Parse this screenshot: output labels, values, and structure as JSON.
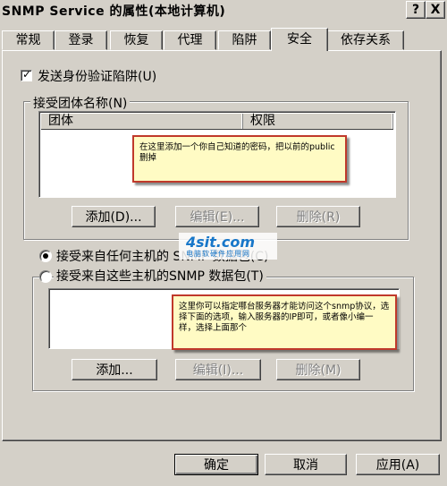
{
  "window": {
    "title": "SNMP Service 的属性(本地计算机)",
    "help_glyph": "?",
    "close_glyph": "X"
  },
  "tabs": [
    {
      "label": "常规"
    },
    {
      "label": "登录"
    },
    {
      "label": "恢复"
    },
    {
      "label": "代理"
    },
    {
      "label": "陷阱"
    },
    {
      "label": "安全"
    },
    {
      "label": "依存关系"
    }
  ],
  "security": {
    "send_auth_trap": {
      "label": "发送身份验证陷阱(U)",
      "checked": true
    },
    "communities": {
      "title": "接受团体名称(N)",
      "columns": [
        "团体",
        "权限"
      ],
      "note": "在这里添加一个你自己知道的密码，把以前的public删掉",
      "add_button": "添加(D)...",
      "edit_button": "编辑(E)...",
      "remove_button": "删除(R)"
    },
    "accept_any": {
      "label": "接受来自任何主机的 SNMP 数据包(C)",
      "selected": true
    },
    "accept_these": {
      "label": "接受来自这些主机的SNMP 数据包(T)",
      "selected": false
    },
    "hosts": {
      "note": "这里你可以指定哪台服务器才能访问这个snmp协议，选择下面的选项，输入服务器的IP即可，或者像小编一样，选择上面那个",
      "add_button": "添加...",
      "edit_button": "编辑(I)...",
      "remove_button": "删除(M)"
    }
  },
  "watermark": {
    "logo": "4sit.com",
    "subtitle": "电脑软硬件应用网"
  },
  "footer": {
    "ok_button": "确定",
    "cancel_button": "取消",
    "apply_button": "应用(A)"
  }
}
